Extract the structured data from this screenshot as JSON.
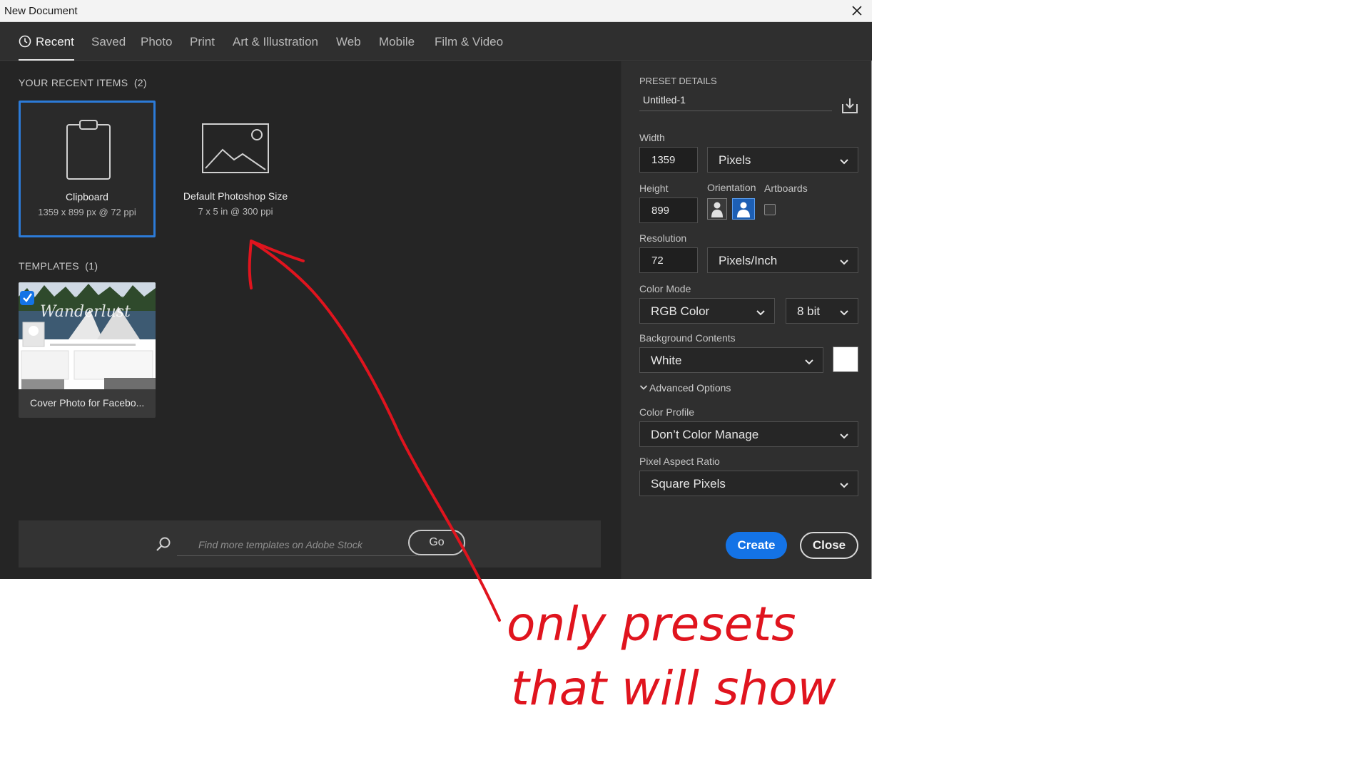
{
  "window": {
    "title": "New Document"
  },
  "tabs": [
    {
      "label": "Recent"
    },
    {
      "label": "Saved"
    },
    {
      "label": "Photo"
    },
    {
      "label": "Print"
    },
    {
      "label": "Art & Illustration"
    },
    {
      "label": "Web"
    },
    {
      "label": "Mobile"
    },
    {
      "label": "Film & Video"
    }
  ],
  "recent": {
    "heading": "YOUR RECENT ITEMS",
    "count": "(2)",
    "items": [
      {
        "name": "Clipboard",
        "details": "1359 x 899 px @ 72 ppi"
      },
      {
        "name": "Default Photoshop Size",
        "details": "7 x 5 in @ 300 ppi"
      }
    ]
  },
  "templates": {
    "heading": "TEMPLATES",
    "count": "(1)",
    "items": [
      {
        "name": "Cover Photo for Facebo..."
      }
    ]
  },
  "search": {
    "placeholder": "Find more templates on Adobe Stock",
    "go_label": "Go"
  },
  "preset": {
    "heading": "PRESET DETAILS",
    "doc_name": "Untitled-1",
    "width_label": "Width",
    "width_value": "1359",
    "width_unit": "Pixels",
    "height_label": "Height",
    "height_value": "899",
    "orientation_label": "Orientation",
    "artboards_label": "Artboards",
    "resolution_label": "Resolution",
    "resolution_value": "72",
    "resolution_unit": "Pixels/Inch",
    "color_mode_label": "Color Mode",
    "color_mode": "RGB Color",
    "bit_depth": "8 bit",
    "background_label": "Background Contents",
    "background": "White",
    "background_color": "#ffffff",
    "advanced_label": "Advanced Options",
    "color_profile_label": "Color Profile",
    "color_profile": "Don’t Color Manage",
    "pixel_aspect_label": "Pixel Aspect Ratio",
    "pixel_aspect": "Square Pixels"
  },
  "buttons": {
    "create": "Create",
    "close": "Close"
  },
  "annotation": {
    "line1": "only presets",
    "line2": "that will show",
    "color": "#e0141e"
  },
  "colors": {
    "accent": "#1473e6",
    "panel_bg": "#2b2b2b"
  }
}
